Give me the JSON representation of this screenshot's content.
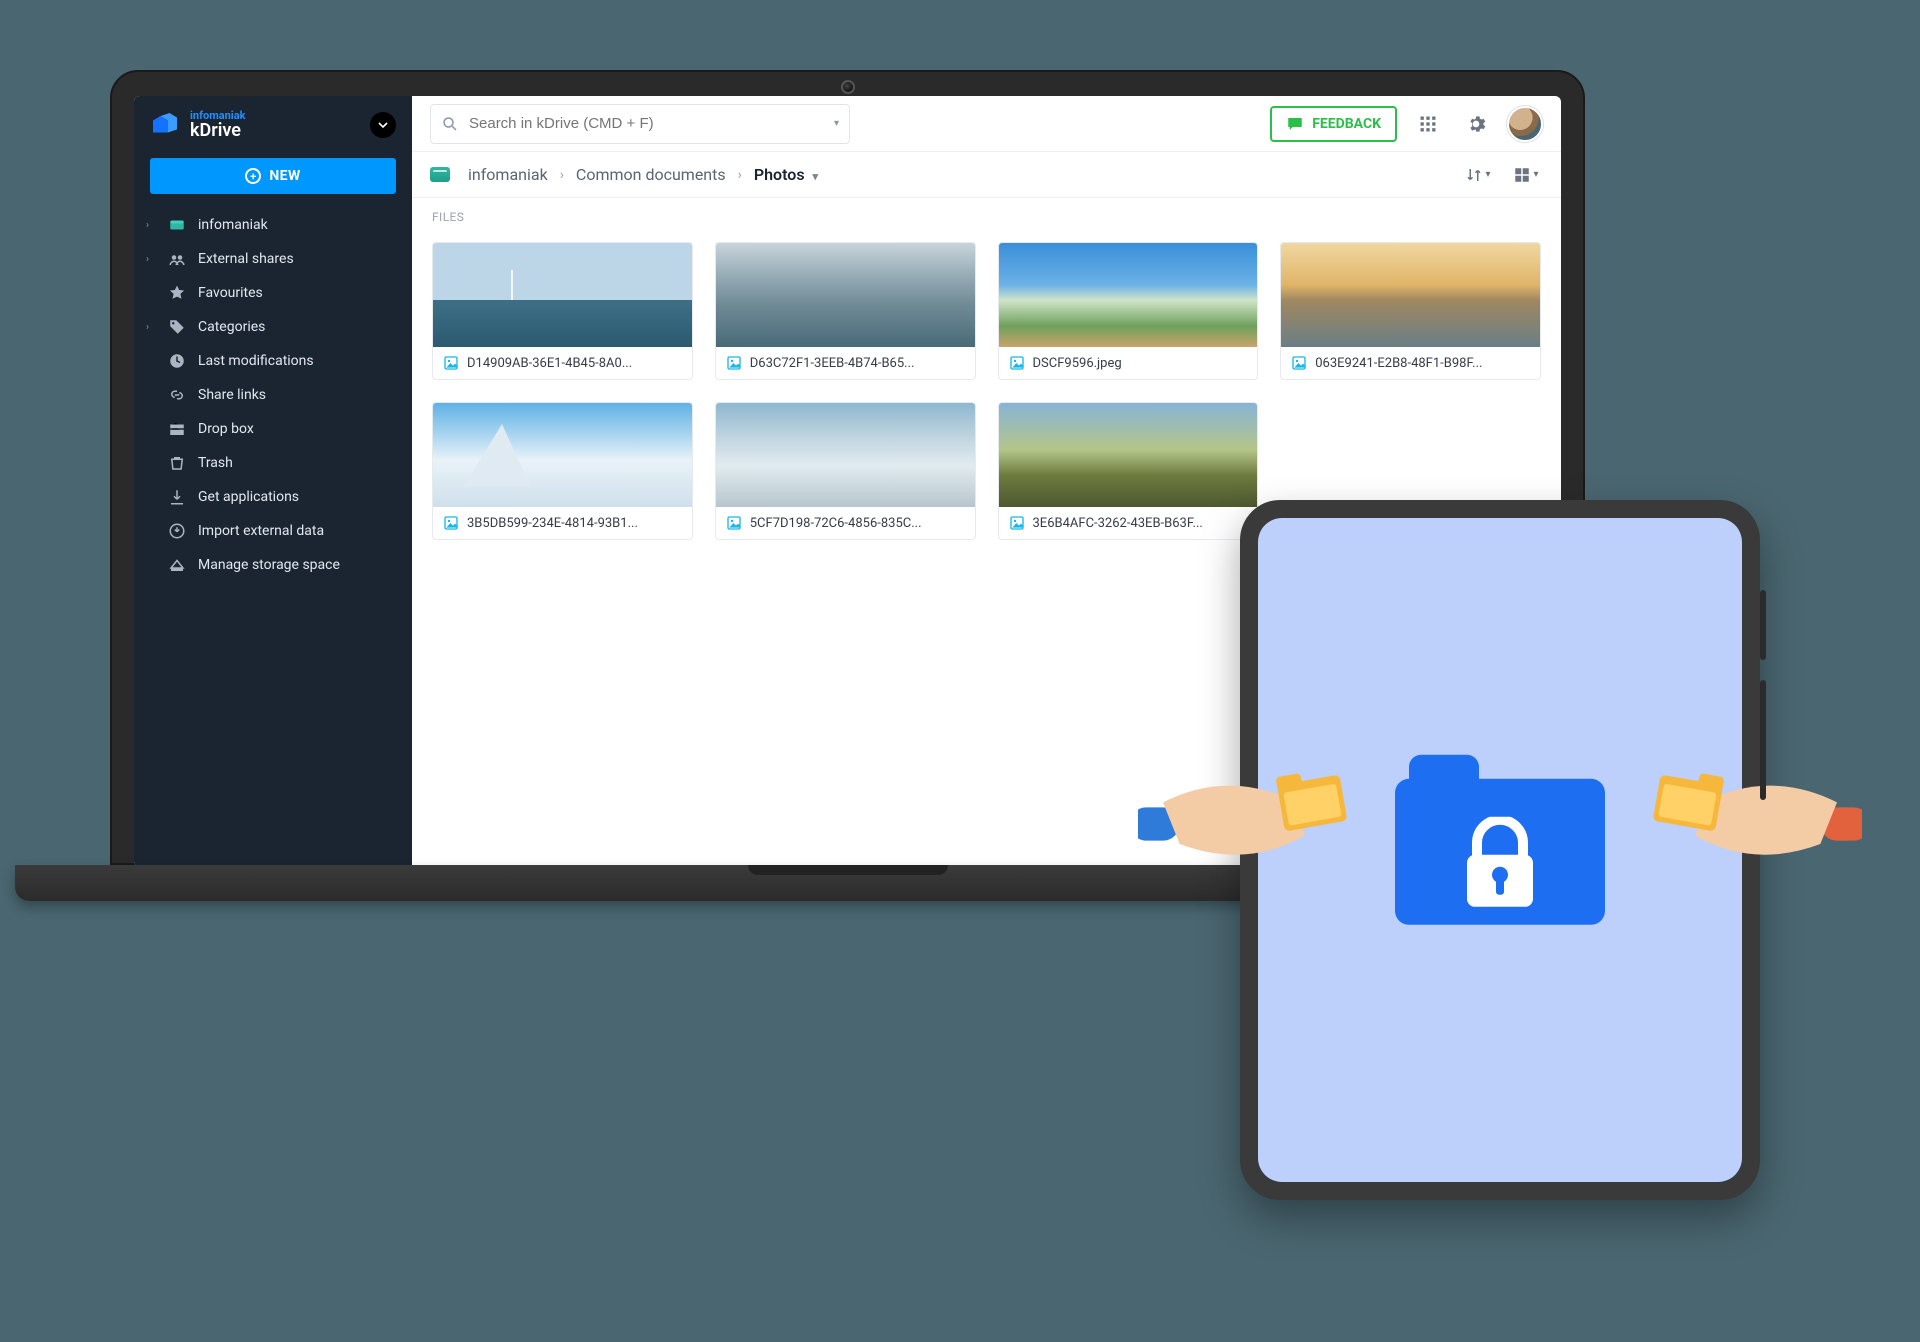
{
  "brand": {
    "sub": "infomaniak",
    "main": "kDrive"
  },
  "sidebar": {
    "new_label": "NEW",
    "items": [
      {
        "label": "infomaniak",
        "icon": "drive",
        "expandable": true
      },
      {
        "label": "External shares",
        "icon": "shares",
        "expandable": true
      },
      {
        "label": "Favourites",
        "icon": "star",
        "expandable": false
      },
      {
        "label": "Categories",
        "icon": "tag",
        "expandable": true
      },
      {
        "label": "Last modifications",
        "icon": "clock",
        "expandable": false
      },
      {
        "label": "Share links",
        "icon": "link",
        "expandable": false
      },
      {
        "label": "Drop box",
        "icon": "dropbox",
        "expandable": false
      },
      {
        "label": "Trash",
        "icon": "trash",
        "expandable": false
      },
      {
        "label": "Get applications",
        "icon": "download",
        "expandable": false
      },
      {
        "label": "Import external data",
        "icon": "import",
        "expandable": false
      },
      {
        "label": "Manage storage space",
        "icon": "storage",
        "expandable": false
      }
    ]
  },
  "search": {
    "placeholder": "Search in kDrive (CMD + F)"
  },
  "topbar": {
    "feedback_label": "FEEDBACK"
  },
  "breadcrumbs": {
    "drive": "infomaniak",
    "folder": "Common documents",
    "current": "Photos"
  },
  "files_section_label": "FILES",
  "files": [
    {
      "name": "D14909AB-36E1-4B45-8A0..."
    },
    {
      "name": "D63C72F1-3EEB-4B74-B65..."
    },
    {
      "name": "DSCF9596.jpeg"
    },
    {
      "name": "063E9241-E2B8-48F1-B98F..."
    },
    {
      "name": "3B5DB599-234E-4814-93B1..."
    },
    {
      "name": "5CF7D198-72C6-4856-835C..."
    },
    {
      "name": "3E6B4AFC-3262-43EB-B63F..."
    }
  ]
}
